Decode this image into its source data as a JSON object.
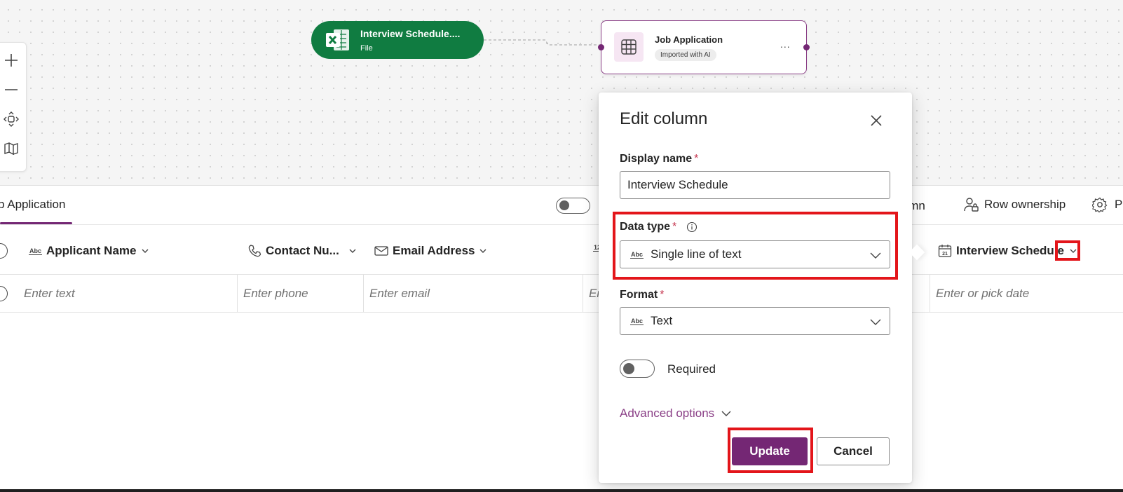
{
  "canvas": {
    "file_node": {
      "title": "Interview Schedule....",
      "subtitle": "File",
      "icon": "excel-icon"
    },
    "table_node": {
      "title": "Job Application",
      "badge": "Imported with AI",
      "more": "...",
      "icon": "table-grid-icon"
    },
    "zoom_controls": [
      "zoom-in-icon",
      "zoom-out-icon",
      "fit-view-icon",
      "map-icon"
    ]
  },
  "toolbar": {
    "tab": "b Application",
    "column_button": "lumn",
    "row_ownership": "Row ownership",
    "properties": "Pr"
  },
  "table": {
    "headers": [
      {
        "label": "Applicant Name",
        "icon": "text-abc-icon"
      },
      {
        "label": "Contact Nu...",
        "icon": "phone-icon"
      },
      {
        "label": "Email Address",
        "icon": "mail-icon"
      },
      {
        "label": "Interview Schedule",
        "icon": "calendar-icon"
      }
    ],
    "placeholders": [
      "Enter text",
      "Enter phone",
      "Enter email",
      "En",
      "Enter or pick date"
    ],
    "abc_glyph": "Abc",
    "calendar_day": "21",
    "number_glyph": "12"
  },
  "dialog": {
    "title": "Edit column",
    "display_name_label": "Display name",
    "display_name_value": "Interview Schedule",
    "data_type_label": "Data type",
    "data_type_value": "Single line of text",
    "format_label": "Format",
    "format_value": "Text",
    "required_label": "Required",
    "required_on": false,
    "advanced_options": "Advanced options",
    "update_button": "Update",
    "cancel_button": "Cancel",
    "required_marker": "*"
  },
  "colors": {
    "accent": "#742774",
    "excel_green": "#107c41",
    "highlight_red": "#e3151a"
  }
}
